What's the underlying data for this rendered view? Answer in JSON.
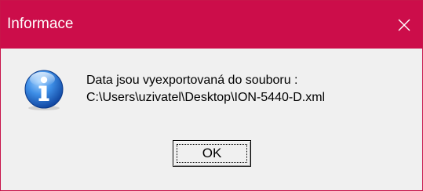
{
  "window": {
    "title": "Informace",
    "titlebar_color": "#cc0d4a",
    "background_color": "#f0f0f0",
    "close_icon": "close-icon"
  },
  "message": {
    "icon": "information-icon",
    "line1": "Data jsou vyexportovaná do souboru :",
    "line2": "C:\\Users\\uzivatel\\Desktop\\ION-5440-D.xml"
  },
  "buttons": {
    "ok_label": "OK"
  }
}
